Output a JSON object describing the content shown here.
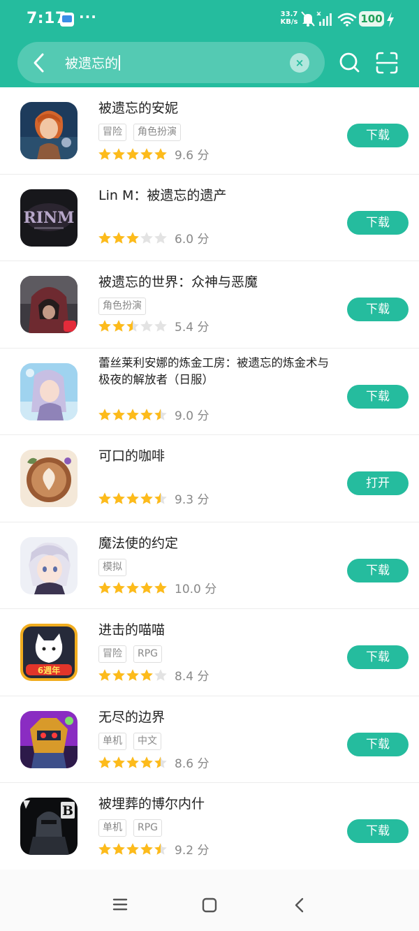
{
  "status_bar": {
    "time": "7:17",
    "dots": "···",
    "speed_value": "33.7",
    "speed_unit": "KB/s",
    "battery": "100"
  },
  "search": {
    "query": "被遗忘的",
    "clear_symbol": "×"
  },
  "apps": [
    {
      "name": "被遗忘的安妮",
      "tags": [
        "冒险",
        "角色扮演"
      ],
      "stars": 5,
      "score": "9.6 分",
      "action": "下载",
      "icon": "annie-icon"
    },
    {
      "name": "Lin M：被遗忘的遗产",
      "tags": [],
      "stars": 3,
      "score": "6.0 分",
      "action": "下载",
      "icon": "lin-m-icon"
    },
    {
      "name": "被遗忘的世界：众神与恶魔",
      "tags": [
        "角色扮演"
      ],
      "stars": 2.5,
      "score": "5.4 分",
      "action": "下载",
      "icon": "forgotten-world-icon"
    },
    {
      "name": "蕾丝莱利安娜的炼金工房：被遗忘的炼金术与极夜的解放者（日服）",
      "tags": [],
      "stars": 4.5,
      "score": "9.0 分",
      "action": "下载",
      "icon": "atelier-icon"
    },
    {
      "name": "可口的咖啡",
      "tags": [],
      "stars": 4.5,
      "score": "9.3 分",
      "action": "打开",
      "icon": "coffee-icon"
    },
    {
      "name": "魔法使的约定",
      "tags": [
        "模拟"
      ],
      "stars": 5,
      "score": "10.0 分",
      "action": "下载",
      "icon": "mahoyaku-icon"
    },
    {
      "name": "进击的喵喵",
      "tags": [
        "冒险",
        "RPG"
      ],
      "stars": 4,
      "score": "8.4 分",
      "action": "下载",
      "icon": "battle-cats-icon"
    },
    {
      "name": "无尽的边界",
      "tags": [
        "单机",
        "中文"
      ],
      "stars": 4.5,
      "score": "8.6 分",
      "action": "下载",
      "icon": "endless-frontier-icon"
    },
    {
      "name": "被埋葬的博尔内什",
      "tags": [
        "单机",
        "RPG"
      ],
      "stars": 4.5,
      "score": "9.2 分",
      "action": "下载",
      "icon": "bornethia-icon"
    }
  ],
  "icon_art": {
    "annie-icon": {
      "label": ""
    },
    "lin-m-icon": {
      "label": "RINM"
    },
    "forgotten-world-icon": {
      "label": ""
    },
    "atelier-icon": {
      "label": ""
    },
    "coffee-icon": {
      "label": ""
    },
    "mahoyaku-icon": {
      "label": ""
    },
    "battle-cats-icon": {
      "label": "6週年"
    },
    "endless-frontier-icon": {
      "label": ""
    },
    "bornethia-icon": {
      "label": "B"
    }
  },
  "colors": {
    "accent": "#25bc9e",
    "star_on": "#fdbb1b",
    "star_off": "#e3e3e3"
  }
}
